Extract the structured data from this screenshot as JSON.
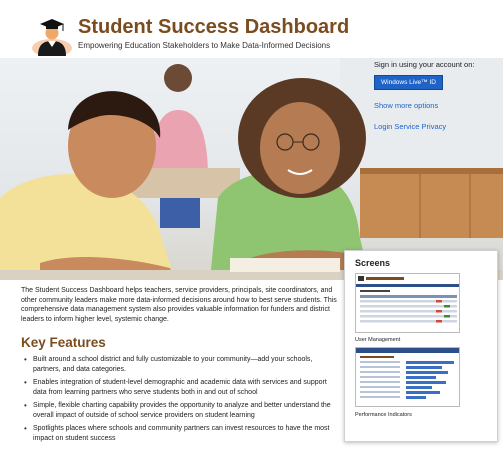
{
  "header": {
    "title": "Student Success Dashboard",
    "subtitle": "Empowering Education Stakeholders to Make Data-Informed Decisions",
    "logo_icon": "graduate-cap-icon"
  },
  "signin": {
    "label": "Sign in using your account on:",
    "button_label": "Windows Live™ ID",
    "show_more": "Show more options",
    "privacy": "Login Service Privacy"
  },
  "main": {
    "intro": "The Student Success Dashboard helps teachers, service providers, principals, site coordinators, and other community leaders make more data-informed decisions around how to best serve students. This comprehensive data management system also provides valuable information for funders and district leaders to inform higher level, systemic change.",
    "key_features_title": "Key Features",
    "features": [
      "Built around a school district and fully customizable to your community—add your schools, partners, and data categories.",
      "Enables integration of student-level demographic and academic data with services and support data from learning partners who serve students both in and out of school",
      "Simple, flexible charting capability provides the opportunity to analyze and better understand the overall impact of outside of school service providers on student learning",
      "Spotlights places where schools and community partners can invest resources to have the most impact on student success"
    ]
  },
  "screens": {
    "title": "Screens",
    "items": [
      {
        "caption": "User Management"
      },
      {
        "caption": "Performance Indicators"
      }
    ]
  },
  "colors": {
    "brand_brown": "#7b4c1e",
    "link_blue": "#1f63c7"
  }
}
